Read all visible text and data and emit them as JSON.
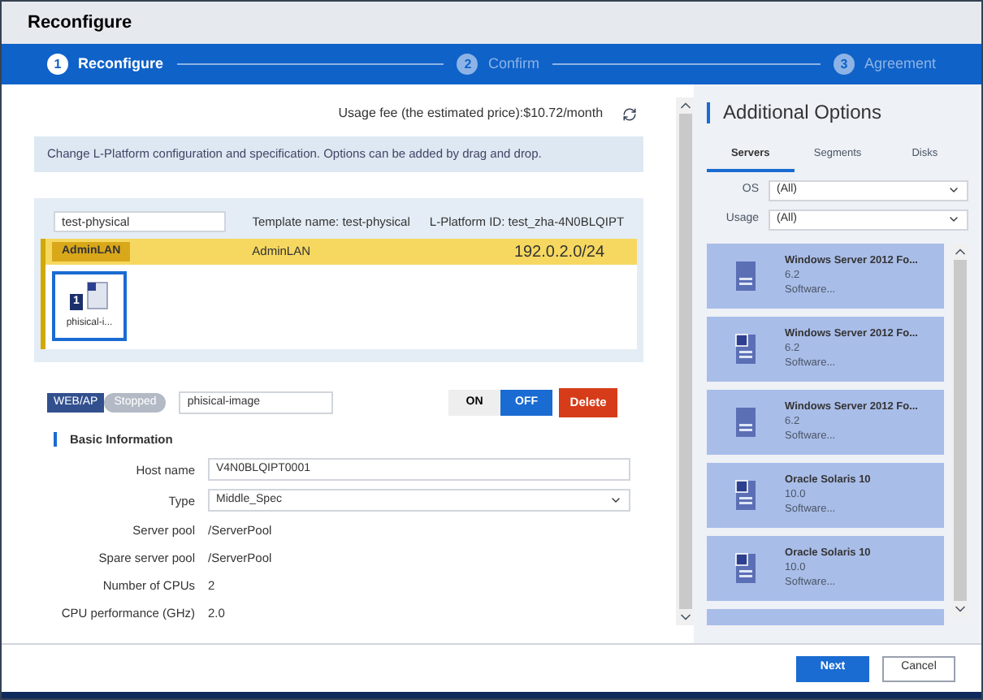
{
  "window": {
    "title": "Reconfigure"
  },
  "steps": [
    {
      "number": "1",
      "label": "Reconfigure",
      "selected": true
    },
    {
      "number": "2",
      "label": "Confirm",
      "selected": false
    },
    {
      "number": "3",
      "label": "Agreement",
      "selected": false
    }
  ],
  "usage_fee": "Usage fee (the estimated price):$10.72/month",
  "info": "Change L-Platform configuration and specification. Options can be added by drag and drop.",
  "platform": {
    "name": "test-physical",
    "template": "Template name: test-physical",
    "id": "L-Platform ID: test_zha-4N0BLQIPT"
  },
  "segment": {
    "badge": "AdminLAN",
    "name": "AdminLAN",
    "address": "192.0.2.0/24"
  },
  "server_tiles": [
    {
      "number": "1",
      "label": "phisical-i...",
      "selected": true
    }
  ],
  "server_detail": {
    "role": "WEB/AP",
    "status": "Stopped",
    "name": "phisical-image",
    "power": [
      {
        "label": "ON",
        "selected": false
      },
      {
        "label": "OFF",
        "selected": true
      }
    ],
    "delete": "Delete",
    "section": "Basic Information",
    "fields": [
      {
        "kind": "input",
        "label": "Host name",
        "value": "V4N0BLQIPT0001"
      },
      {
        "kind": "select",
        "label": "Type",
        "value": "Middle_Spec"
      },
      {
        "kind": "text",
        "label": "Server pool",
        "value": "/ServerPool"
      },
      {
        "kind": "text",
        "label": "Spare server pool",
        "value": "/ServerPool"
      },
      {
        "kind": "text",
        "label": "Number of CPUs",
        "value": "2"
      },
      {
        "kind": "text",
        "label": "CPU performance (GHz)",
        "value": "2.0"
      }
    ]
  },
  "options": {
    "title": "Additional Options",
    "tabs": [
      {
        "label": "Servers",
        "selected": true
      },
      {
        "label": "Segments",
        "selected": false
      },
      {
        "label": "Disks",
        "selected": false
      }
    ],
    "filters": [
      {
        "label": "OS",
        "value": "(All)"
      },
      {
        "label": "Usage",
        "value": "(All)"
      }
    ],
    "cards": [
      {
        "kind": "plain",
        "title": "Windows Server 2012 Fo...",
        "version": "6.2",
        "description": "Software..."
      },
      {
        "kind": "tagged",
        "title": "Windows Server 2012 Fo...",
        "version": "6.2",
        "description": "Software..."
      },
      {
        "kind": "plain",
        "title": "Windows Server 2012 Fo...",
        "version": "6.2",
        "description": "Software..."
      },
      {
        "kind": "tagged",
        "title": "Oracle Solaris 10",
        "version": "10.0",
        "description": "Software..."
      },
      {
        "kind": "tagged",
        "title": "Oracle Solaris 10",
        "version": "10.0",
        "description": "Software..."
      }
    ]
  },
  "footer": [
    {
      "label": "Next",
      "kind": "primary"
    },
    {
      "label": "Cancel",
      "kind": "secondary"
    }
  ]
}
